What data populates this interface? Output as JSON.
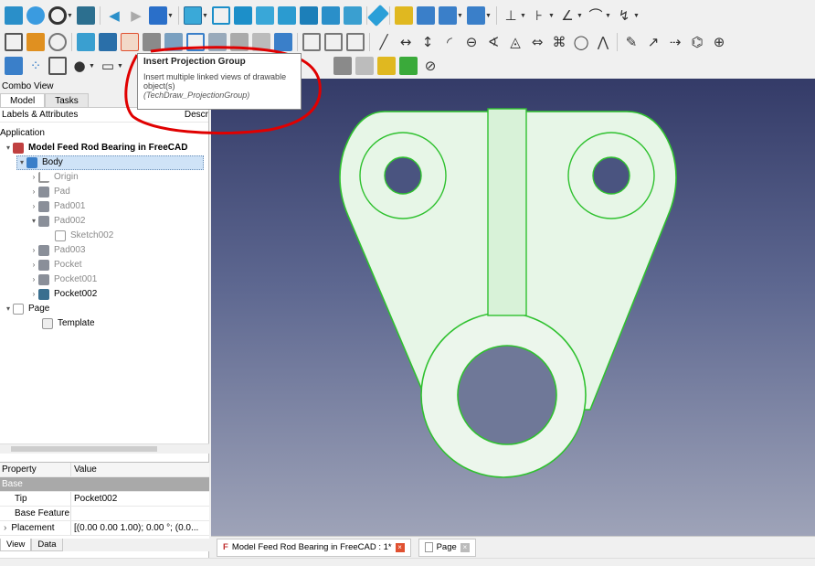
{
  "colors": {
    "accent": "#3aa9d8",
    "highlight_circle": "#e00000",
    "part_fill": "#eaf8ea",
    "part_edge": "#2fc12f",
    "selected": "#cfe3f7"
  },
  "combo": {
    "title": "Combo View",
    "tabs": [
      "Model",
      "Tasks"
    ],
    "header_left": "Labels & Attributes",
    "header_right": "Descr",
    "root": "Application",
    "tree": [
      {
        "label": "Model Feed Rod Bearing in FreeCAD",
        "bold": true
      },
      {
        "label": "Body"
      },
      {
        "label": "Origin"
      },
      {
        "label": "Pad"
      },
      {
        "label": "Pad001"
      },
      {
        "label": "Pad002"
      },
      {
        "label": "Sketch002"
      },
      {
        "label": "Pad003"
      },
      {
        "label": "Pocket"
      },
      {
        "label": "Pocket001"
      },
      {
        "label": "Pocket002"
      },
      {
        "label": "Page"
      },
      {
        "label": "Template"
      }
    ]
  },
  "properties": {
    "col1": "Property",
    "col2": "Value",
    "group": "Base",
    "rows": [
      {
        "name": "Tip",
        "value": "Pocket002"
      },
      {
        "name": "Base Feature",
        "value": ""
      },
      {
        "name": "Placement",
        "value": "[(0.00 0.00 1.00); 0.00 °; (0.0..."
      }
    ]
  },
  "view_tabs": [
    "View",
    "Data"
  ],
  "tooltip": {
    "title": "Insert Projection Group",
    "desc": "Insert multiple linked views of drawable object(s)",
    "cmd": "(TechDraw_ProjectionGroup)"
  },
  "doc_tabs": [
    {
      "label": "Model Feed Rod Bearing in FreeCAD : 1*"
    },
    {
      "label": "Page"
    }
  ]
}
